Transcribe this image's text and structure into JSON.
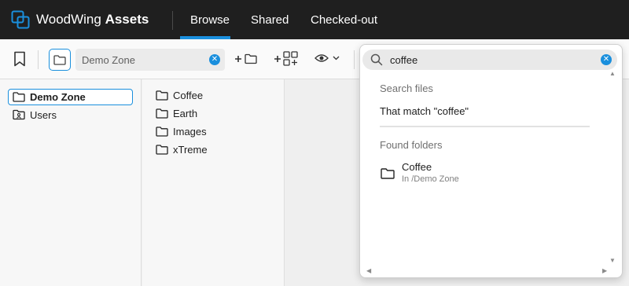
{
  "app": {
    "brand_regular": "WoodWing",
    "brand_bold": "Assets"
  },
  "nav": {
    "tabs": [
      {
        "label": "Browse",
        "active": true
      },
      {
        "label": "Shared"
      },
      {
        "label": "Checked-out"
      }
    ],
    "accent_color": "#1a8fdd"
  },
  "toolbar": {
    "path_value": "Demo Zone",
    "icons": [
      "bookmark-icon",
      "folder-icon",
      "new-folder-icon",
      "new-collection-icon",
      "preview-eye-icon"
    ]
  },
  "search": {
    "value": "coffee"
  },
  "tree": {
    "root_items": [
      {
        "label": "Demo Zone",
        "selected": true,
        "icon": "folder-icon"
      },
      {
        "label": "Users",
        "icon": "users-folder-icon"
      }
    ],
    "sub_items": [
      {
        "label": "Coffee"
      },
      {
        "label": "Earth"
      },
      {
        "label": "Images"
      },
      {
        "label": "xTreme"
      }
    ]
  },
  "dropdown": {
    "search_files_heading": "Search files",
    "match_label": "That match \"coffee\"",
    "found_folders_heading": "Found folders",
    "results": [
      {
        "name": "Coffee",
        "path": "In /Demo Zone"
      }
    ]
  }
}
